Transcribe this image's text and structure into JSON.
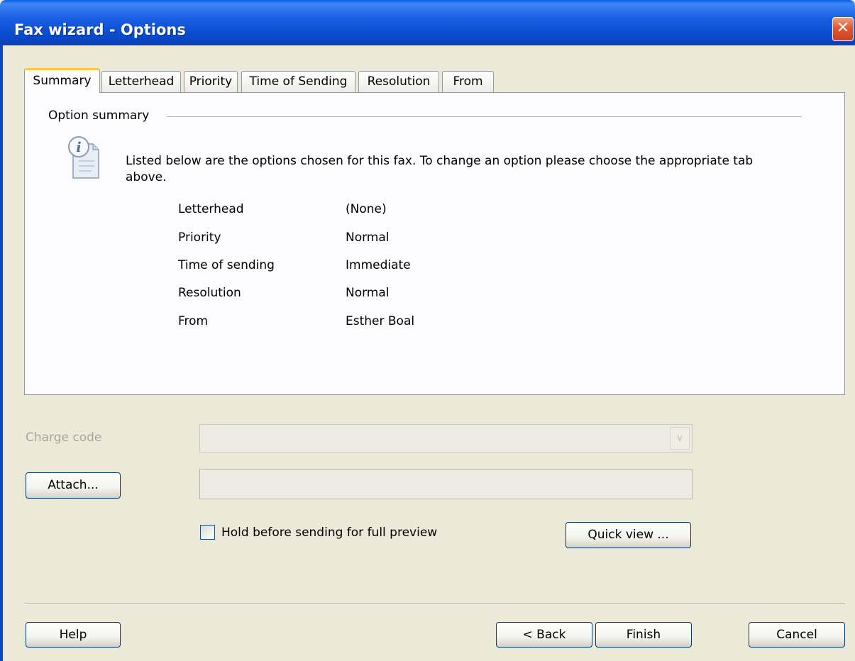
{
  "window": {
    "title": "Fax wizard - Options",
    "close_glyph": "✕"
  },
  "tabs": [
    {
      "label": "Summary",
      "active": true
    },
    {
      "label": "Letterhead",
      "active": false
    },
    {
      "label": "Priority",
      "active": false
    },
    {
      "label": "Time of Sending",
      "active": false
    },
    {
      "label": "Resolution",
      "active": false
    },
    {
      "label": "From",
      "active": false
    }
  ],
  "summary": {
    "group_label": "Option summary",
    "icon": "info-document-icon",
    "description": "Listed below are the options chosen for this fax. To change an option please choose the appropriate tab above.",
    "rows": [
      {
        "label": "Letterhead",
        "value": "(None)"
      },
      {
        "label": "Priority",
        "value": "Normal"
      },
      {
        "label": "Time of sending",
        "value": "Immediate"
      },
      {
        "label": "Resolution",
        "value": "Normal"
      },
      {
        "label": "From",
        "value": "Esther Boal"
      }
    ]
  },
  "charge_code": {
    "label": "Charge code",
    "value": "",
    "enabled": false
  },
  "attach": {
    "button_label": "Attach...",
    "value": ""
  },
  "hold_preview": {
    "label": "Hold before sending for full preview",
    "checked": false
  },
  "quick_view": {
    "label": "Quick view ..."
  },
  "footer": {
    "help": "Help",
    "back": "< Back",
    "finish": "Finish",
    "cancel": "Cancel"
  },
  "colors": {
    "titlebar": "#0b4fd3",
    "close": "#e2582f",
    "active_tab_accent": "#ffc83c",
    "dialog_bg": "#ece9d8"
  }
}
